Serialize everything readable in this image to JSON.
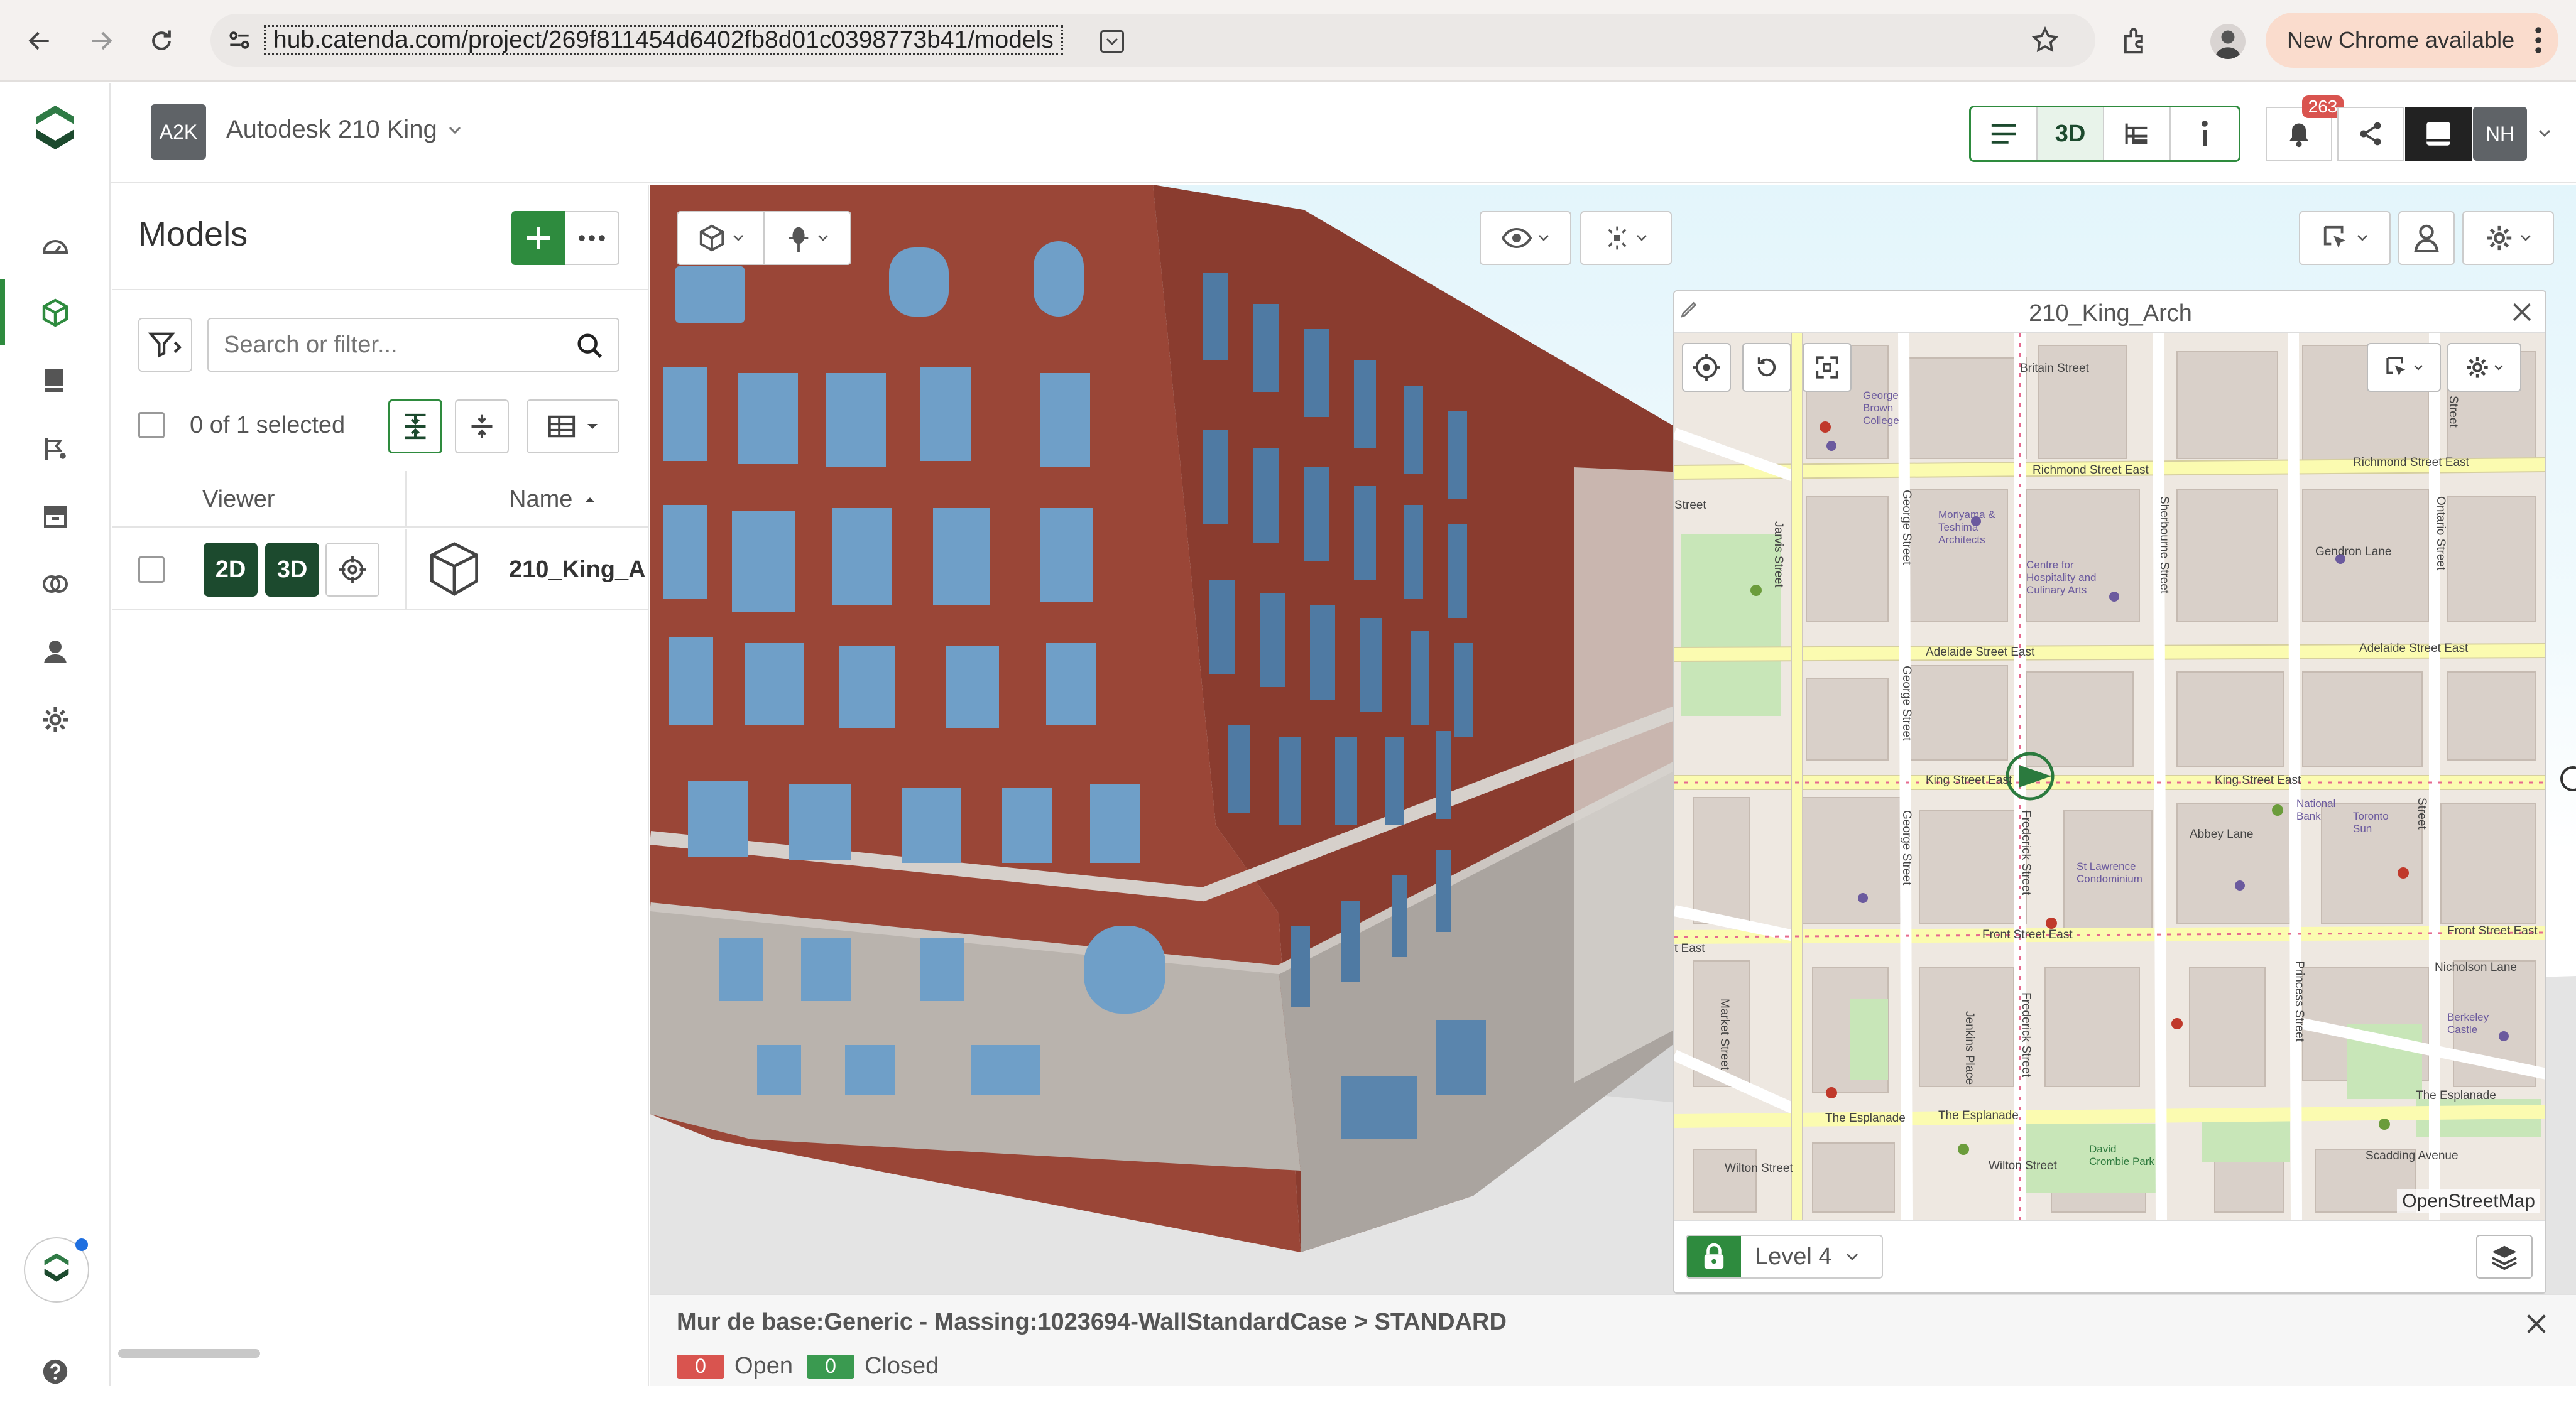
{
  "browser": {
    "url": "hub.catenda.com/project/269f811454d6402fb8d01c0398773b41/models",
    "chrome_notice": "New Chrome available"
  },
  "header": {
    "project_badge": "A2K",
    "project_name": "Autodesk 210 King",
    "view_3d_label": "3D",
    "notification_count": "263",
    "user_initials": "NH"
  },
  "models_panel": {
    "title": "Models",
    "search_placeholder": "Search or filter...",
    "selection_status": "0 of 1 selected",
    "columns": {
      "viewer": "Viewer",
      "name": "Name"
    },
    "rows": [
      {
        "btn_2d": "2D",
        "btn_3d": "3D",
        "name": "210_King_A"
      }
    ]
  },
  "map": {
    "title": "210_King_Arch",
    "attribution": "OpenStreetMap",
    "level": "Level 4",
    "streets": [
      "Britain Street",
      "Richmond Street East",
      "Richmond Street East",
      "Adelaide Street East",
      "Adelaide Street East",
      "King Street East",
      "King Street East",
      "Front Street East",
      "Front Street East",
      "The Esplanade",
      "The Esplanade",
      "The Esplanade",
      "Wilton Street",
      "Wilton Street",
      "Scadding Avenue",
      "Abbey Lane",
      "Nicholson Lane",
      "Gendron Lane",
      "Jarvis Street",
      "George Street",
      "George Street",
      "George Street",
      "Sherbourne Street",
      "Ontario Street",
      "Frederick Street",
      "Frederick Street",
      "Princess Street",
      "Market Street",
      "Jenkins Place",
      "Street",
      "Street",
      "Street",
      "t East"
    ],
    "places": [
      "George Brown College",
      "Centre for Hospitality and Culinary Arts",
      "Moriyama & Teshima Architects",
      "St Lawrence Condominium",
      "Toronto Sun",
      "David Crombie Park",
      "Berkeley Castle",
      "National Bank"
    ]
  },
  "footer": {
    "title": "Mur de base:Generic - Massing:1023694-WallStandardCase > STANDARD",
    "open_count": "0",
    "open_label": "Open",
    "closed_count": "0",
    "closed_label": "Closed"
  },
  "colors": {
    "brand_green": "#1c4a2e",
    "accent_green": "#2e8b3e",
    "open_red": "#d9544f",
    "closed_green": "#3a9a50",
    "brick": "#9a4637"
  },
  "icons": [
    "back-icon",
    "forward-icon",
    "reload-icon",
    "site-settings-icon",
    "bookmark-star-icon",
    "extensions-icon",
    "profile-icon",
    "menu-dots-icon",
    "catenda-logo",
    "dashboard-icon",
    "models-icon",
    "documents-icon",
    "issues-icon",
    "archive-icon",
    "integrations-icon",
    "people-icon",
    "settings-icon",
    "help-icon",
    "list-view-icon",
    "tree-view-icon",
    "info-icon",
    "bell-icon",
    "share-icon",
    "panel-toggle-icon",
    "plus-icon",
    "more-icon",
    "filter-icon",
    "search-icon",
    "expand-icon",
    "collapse-icon",
    "layout-icon",
    "target-icon",
    "cube-icon",
    "visibility-icon",
    "explode-icon",
    "select-tool-icon",
    "person-icon",
    "gear-icon",
    "pencil-icon",
    "close-icon",
    "locate-icon",
    "reset-rotation-icon",
    "fullscreen-icon",
    "lock-icon",
    "layers-icon",
    "chevron-down-icon",
    "sort-up-icon"
  ]
}
